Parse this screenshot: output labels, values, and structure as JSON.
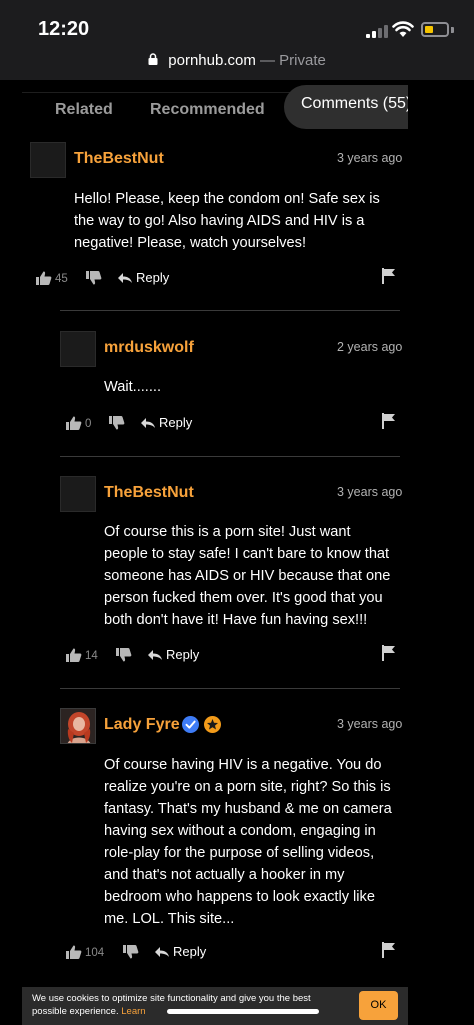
{
  "status_bar": {
    "time": "12:20"
  },
  "url_bar": {
    "domain": "pornhub.com",
    "suffix": " — Private"
  },
  "tabs": [
    {
      "label": "Related"
    },
    {
      "label": "Recommended"
    },
    {
      "label": "Comments (55)"
    }
  ],
  "comments": [
    {
      "username": "TheBestNut",
      "time": "3 years ago",
      "lines": [
        "Hello! Please, keep the condom on! Safe sex is",
        "the way to go! Also having AIDS and HIV is a",
        "negative! Please, watch yourselves!"
      ],
      "likes": "45",
      "reply_label": "Reply",
      "avatar_icon": "default-avatar"
    },
    {
      "username": "mrduskwolf",
      "time": "2 years ago",
      "lines": [
        "Wait......."
      ],
      "likes": "0",
      "reply_label": "Reply",
      "avatar_icon": "default-avatar"
    },
    {
      "username": "TheBestNut",
      "time": "3 years ago",
      "lines": [
        "Of course this is a porn site! Just want",
        "people to stay safe! I can't bare to know that",
        "someone has AIDS or HIV because that one",
        "person fucked them over. It's good that you",
        "both don't have it! Have fun having sex!!!"
      ],
      "likes": "14",
      "reply_label": "Reply",
      "avatar_icon": "default-avatar"
    },
    {
      "username": "Lady Fyre",
      "time": "3 years ago",
      "lines": [
        "Of course having HIV is a negative. You do",
        "realize you're on a porn site, right? So this is",
        "fantasy. That's my husband & me on camera",
        "having sex without a condom, engaging in",
        "role-play for the purpose of selling videos,",
        "and that's not actually a hooker in my",
        "bedroom who happens to look exactly like",
        "me. LOL. This site..."
      ],
      "likes": "104",
      "reply_label": "Reply",
      "avatar_icon": "profile-photo",
      "badges": [
        "verified-check-icon",
        "star-badge-icon"
      ]
    }
  ],
  "cookie_banner": {
    "text": "We use cookies to optimize site functionality and give you the best possible experience.",
    "learn_label": "Learn",
    "ok_label": "OK"
  },
  "colors": {
    "accent": "#f7a23b",
    "background": "#000000",
    "verified": "#3e7cf6",
    "star": "#f29b1a"
  }
}
